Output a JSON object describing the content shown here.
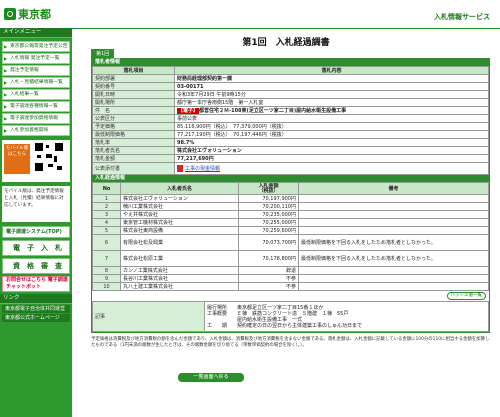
{
  "header": {
    "logo_text": "東京都",
    "service_title": "入札情報サービス"
  },
  "sidebar": {
    "menu_title": "メインメニュー",
    "items": [
      {
        "label": "東京都公報等発注予定公告"
      },
      {
        "label": "入札情報 発注予定一覧"
      },
      {
        "label": "発注予定情報"
      },
      {
        "label": "入札・見積結果情報一覧"
      },
      {
        "label": "入札結果一覧"
      },
      {
        "label": "電子調達各種情報一覧"
      },
      {
        "label": "電子調達参加資格情報"
      },
      {
        "label": "入札参加資格関係"
      }
    ],
    "mobile_badge": "モバイル版 はこちら",
    "mobile_note": "モバイル版は、発注予定情報と入札（見積）結果情報に対応しています。",
    "buttons": [
      {
        "label": "電子調達システム(TOP)"
      },
      {
        "label": "電　子　入　札"
      },
      {
        "label": "資　格　審　査"
      }
    ],
    "pink_banner": "お問合せはこちら 電子調達チャットボット",
    "links_title": "リンク",
    "links": [
      {
        "label": "東京都電子自治体共同運営"
      },
      {
        "label": "東京都公式ホームページ"
      }
    ]
  },
  "main": {
    "page_title": "第1回　入札経過調書",
    "round_tab": "第1回"
  },
  "bid_info": {
    "section_title": "落札者情報",
    "header_item": "落札項目",
    "header_content": "落札内容",
    "rows": [
      {
        "label": "契約部署",
        "value": "財務局経理部契約第一課"
      },
      {
        "label": "契約番号",
        "value": "03-00171"
      },
      {
        "label": "開札日時",
        "value": "令和3年7月29日 午前9時15分"
      },
      {
        "label": "開札場所",
        "value": "都庁第一本庁舎南側15階　第一入札室"
      },
      {
        "label": "件　名",
        "tag": "【電子】",
        "value": "都営住宅２Ｍ-108東(足立区一ツ家二丁目)屋内給水衛生設備工事"
      },
      {
        "label": "公表区分",
        "value": "事前公表"
      },
      {
        "label": "予定価格",
        "value": "85,116,900円（税込）　77,379,000円（税抜）"
      },
      {
        "label": "最低制限価格",
        "value": "77,217,190円（税込）　70,197,446円（税抜）"
      },
      {
        "label": "落札率",
        "value": "98.7%"
      },
      {
        "label": "落札者氏名",
        "value": "株式会社エヴォリューション"
      },
      {
        "label": "落札金額",
        "value": "77,217,690円"
      },
      {
        "label": "公表添付書",
        "value": "工事の現金情報"
      }
    ]
  },
  "bidders": {
    "section_title": "入札経過情報",
    "col_no": "No",
    "col_name": "入札者氏名",
    "col_amount": "入札金額\n（税抜）",
    "col_note": "備考",
    "rows": [
      {
        "no": "1",
        "name": "株式会社エヴォリューション",
        "amount": "70,197,900円",
        "note": ""
      },
      {
        "no": "2",
        "name": "楠川工業株式会社",
        "amount": "70,200,110円",
        "note": ""
      },
      {
        "no": "3",
        "name": "やえ井株式会社",
        "amount": "70,235,000円",
        "note": ""
      },
      {
        "no": "4",
        "name": "東京管工機材株式会社",
        "amount": "70,255,000円",
        "note": ""
      },
      {
        "no": "5",
        "name": "株式会社東商設備",
        "amount": "70,259,600円",
        "note": ""
      },
      {
        "no": "6",
        "name": "有限会社松及興業",
        "amount": "70,073,700円",
        "note": "最低制限価格を下回る入札をしたため落札者としなかった。"
      },
      {
        "no": "7",
        "name": "株式会社松原工業",
        "amount": "70,178,800円",
        "note": "最低制限価格を下回る入札をしたため落札者としなかった。"
      },
      {
        "no": "8",
        "name": "カンノ工業株式会社",
        "amount": "辞退",
        "note": ""
      },
      {
        "no": "9",
        "name": "長谷川工業株式会社",
        "amount": "不参",
        "note": ""
      },
      {
        "no": "10",
        "name": "丸八土建工業株式会社",
        "amount": "不参",
        "note": ""
      }
    ],
    "hash_button": "ハッシュ値一覧"
  },
  "remarks": {
    "label": "記事",
    "lines": [
      "履行場所　　東京都足立区一ツ家二丁目15番１ほか",
      "工事概要　　Ｅ棟　鉄筋コンクリート造　５階建　１棟　55戸",
      "　　　　　　屋内給水衛生設備工事　一式",
      "工　　期　　契約確定の日の翌日から主体建築工事のしゅん功日まで"
    ]
  },
  "notes": "予定価格は消費税及び地方消費税の額を含んだ金額であり、入札金額は、消費税及び地方消費税を含まない金額である。落札金額は、入札金額に記載している金額に100分の110に相当する金額を加算したものである（1円未満の端数が生じたときは、その端数金額を切り捨てる（単数単価契約の場合を除く）。）。",
  "back_button": "一覧画面へ戻る"
}
